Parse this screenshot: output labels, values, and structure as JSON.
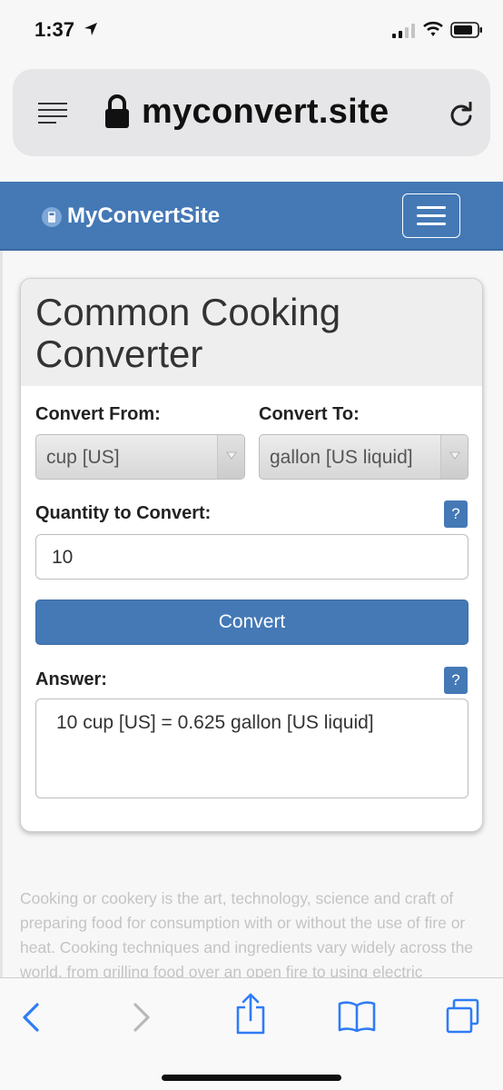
{
  "status_bar": {
    "time": "1:37",
    "icons": [
      "location-arrow-icon",
      "signal-icon",
      "wifi-icon",
      "battery-icon"
    ]
  },
  "browser": {
    "url": "myconvert.site",
    "icons": [
      "reader-mode-icon",
      "lock-icon",
      "reload-icon"
    ]
  },
  "site": {
    "brand": "MyConvertSite",
    "brand_color": "#4479b6"
  },
  "converter": {
    "title": "Common Cooking Converter",
    "from_label": "Convert From:",
    "from_value": "cup [US]",
    "to_label": "Convert To:",
    "to_value": "gallon [US liquid]",
    "quantity_label": "Quantity to Convert:",
    "quantity_value": "10",
    "help_label": "?",
    "convert_label": "Convert",
    "answer_label": "Answer:",
    "answer_value": "10 cup [US] = 0.625 gallon [US liquid]"
  },
  "description": "Cooking or cookery is the art, technology, science and craft of preparing food for consumption with or without the use of fire or heat. Cooking techniques and ingredients vary widely across the world, from grilling food over an open fire to using electric",
  "toolbar": {
    "icons": [
      "back-icon",
      "forward-icon",
      "share-icon",
      "bookmarks-icon",
      "tabs-icon"
    ],
    "accent": "#2f7cf6"
  }
}
